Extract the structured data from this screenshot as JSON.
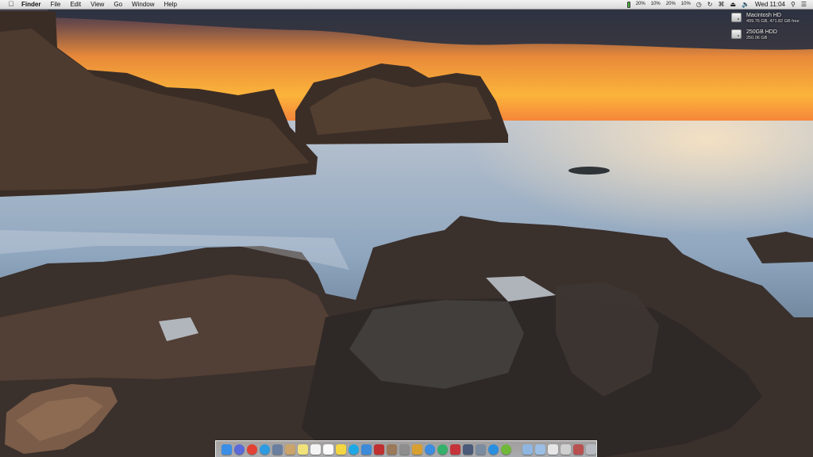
{
  "menubar": {
    "apple_icon": "apple-icon",
    "app_name": "Finder",
    "menus": [
      "File",
      "Edit",
      "View",
      "Go",
      "Window",
      "Help"
    ],
    "cpu_meters": [
      "20%",
      "10%",
      "20%",
      "10%"
    ],
    "icons": [
      "battery-icon",
      "time-machine-icon",
      "sync-icon",
      "wifi-icon",
      "eject-icon",
      "volume-icon",
      "spotlight-icon",
      "notification-center-icon"
    ],
    "clock": "Wed 11:04",
    "colors": {
      "bar": "#e4e4e4",
      "battery": "#46b13a"
    }
  },
  "desktop": {
    "drives": [
      {
        "name": "Macintosh HD",
        "info": "499.76 GB, 471.82 GB free"
      },
      {
        "name": "250GB HDD",
        "info": "250.06 GB"
      }
    ]
  },
  "dock": {
    "apps": [
      {
        "icon": "finder-icon",
        "color": "#3a8ee6"
      },
      {
        "icon": "launchpad-icon",
        "color": "#5a6ad8"
      },
      {
        "icon": "chrome-icon",
        "color": "#e34133"
      },
      {
        "icon": "safari-icon",
        "color": "#2f9be0"
      },
      {
        "icon": "photo-icon",
        "color": "#6a7fa0"
      },
      {
        "icon": "contacts-icon",
        "color": "#caa46a"
      },
      {
        "icon": "notes-icon",
        "color": "#f2e27a"
      },
      {
        "icon": "calendar-icon",
        "color": "#f4f4f4"
      },
      {
        "icon": "textedit-icon",
        "color": "#fafafa"
      },
      {
        "icon": "stickies-icon",
        "color": "#f4d642"
      },
      {
        "icon": "skype-icon",
        "color": "#1fa8e6"
      },
      {
        "icon": "app-store-icon",
        "color": "#3d8bd8"
      },
      {
        "icon": "photo-booth-icon",
        "color": "#c03030"
      },
      {
        "icon": "preview-icon",
        "color": "#9a7a5a"
      },
      {
        "icon": "utility-icon",
        "color": "#8e8e8e"
      },
      {
        "icon": "color-picker-icon",
        "color": "#d8a030"
      },
      {
        "icon": "itunes-icon",
        "color": "#3c8de0"
      },
      {
        "icon": "vine-icon",
        "color": "#33b06a"
      },
      {
        "icon": "filezilla-icon",
        "color": "#c4343a"
      },
      {
        "icon": "dashboard-icon",
        "color": "#4a5a78"
      },
      {
        "icon": "network-icon",
        "color": "#7c8ca0"
      },
      {
        "icon": "appstore-blue-icon",
        "color": "#2b8fe0"
      },
      {
        "icon": "spotify-icon",
        "color": "#70b83a"
      }
    ],
    "stack_items": [
      {
        "icon": "applications-folder-icon",
        "color": "#8fb6e0"
      },
      {
        "icon": "documents-folder-icon",
        "color": "#9bbfe4"
      },
      {
        "icon": "downloads-folder-icon",
        "color": "#e6e6e6"
      },
      {
        "icon": "screenshots-stack-icon",
        "color": "#d0d0d0"
      },
      {
        "icon": "image-stack-icon",
        "color": "#b85050"
      },
      {
        "icon": "trash-icon",
        "color": "#b8bcc2"
      }
    ]
  }
}
